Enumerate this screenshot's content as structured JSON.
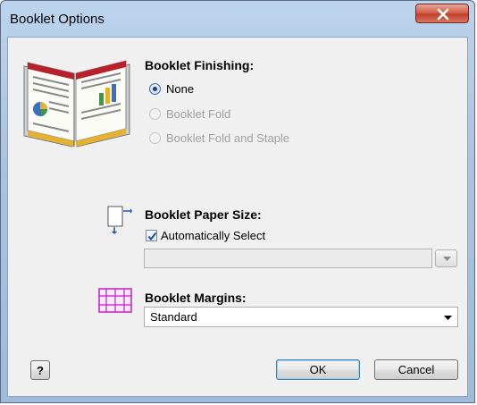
{
  "window": {
    "title": "Booklet Options"
  },
  "finishing": {
    "heading": "Booklet Finishing:",
    "options": [
      {
        "label": "None",
        "selected": true,
        "enabled": true
      },
      {
        "label": "Booklet Fold",
        "selected": false,
        "enabled": false
      },
      {
        "label": "Booklet Fold and Staple",
        "selected": false,
        "enabled": false
      }
    ]
  },
  "paper_size": {
    "heading": "Booklet Paper Size:",
    "auto_select_label": "Automatically Select",
    "auto_select_checked": true,
    "value": ""
  },
  "margins": {
    "heading": "Booklet Margins:",
    "value": "Standard"
  },
  "buttons": {
    "help": "?",
    "ok": "OK",
    "cancel": "Cancel"
  },
  "icons": {
    "close": "close-icon",
    "booklet": "booklet-illustration-icon",
    "paper_size": "paper-size-icon",
    "margins": "margins-icon",
    "dropdown": "chevron-down-icon"
  }
}
